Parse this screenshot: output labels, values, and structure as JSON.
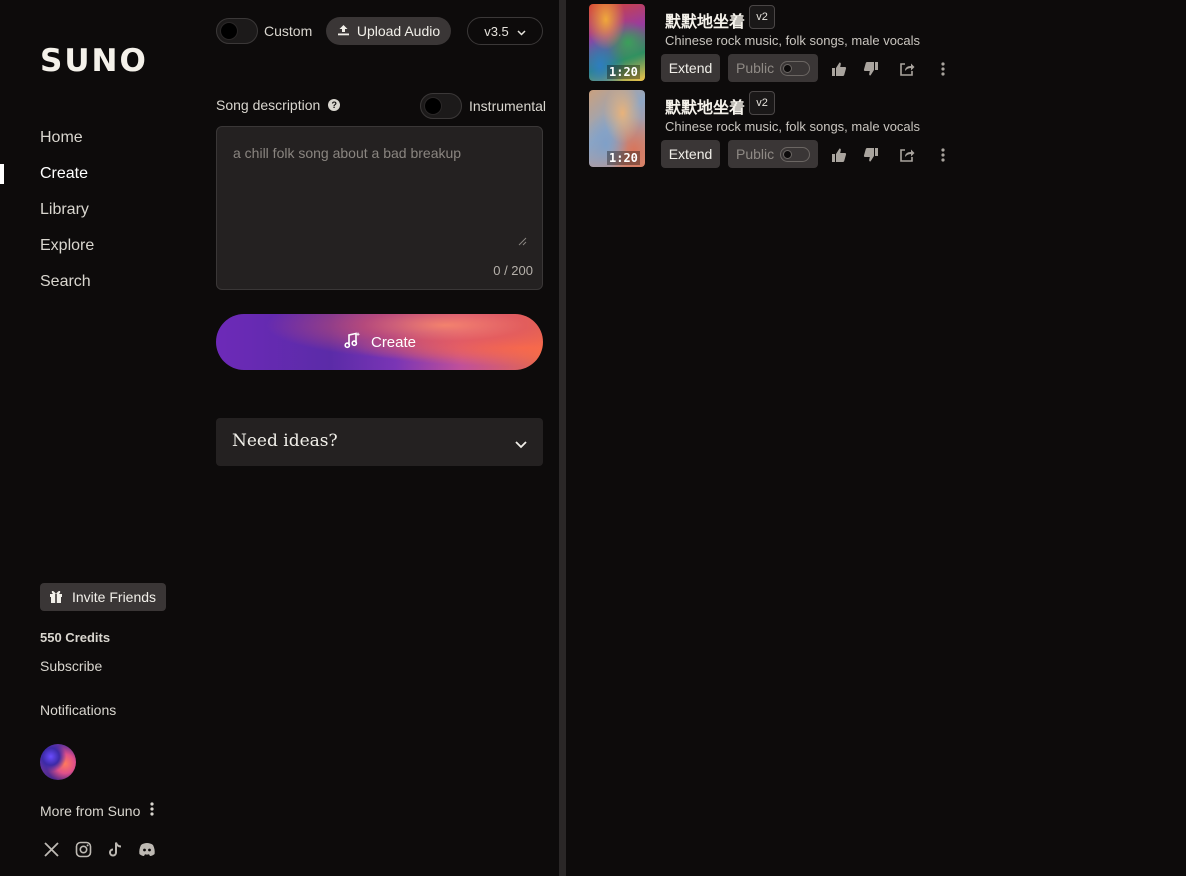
{
  "brand": {
    "logo": "SUNO"
  },
  "sidebar": {
    "nav": [
      {
        "label": "Home",
        "active": false
      },
      {
        "label": "Create",
        "active": true
      },
      {
        "label": "Library",
        "active": false
      },
      {
        "label": "Explore",
        "active": false
      },
      {
        "label": "Search",
        "active": false
      }
    ],
    "invite_label": "Invite Friends",
    "credits": "550 Credits",
    "subscribe": "Subscribe",
    "notifications": "Notifications",
    "more_from": "More from Suno",
    "socials": [
      "x-icon",
      "instagram-icon",
      "tiktok-icon",
      "discord-icon"
    ]
  },
  "create_panel": {
    "custom_label": "Custom",
    "custom_enabled": false,
    "upload_label": "Upload Audio",
    "version": "v3.5",
    "description_label": "Song description",
    "instrumental_label": "Instrumental",
    "instrumental_enabled": false,
    "description_placeholder": "a chill folk song about a bad breakup",
    "description_value": "",
    "counter": "0 / 200",
    "create_label": "Create",
    "ideas_label": "Need ideas?"
  },
  "songs": [
    {
      "title": "默默地坐着",
      "version_badge": "v2",
      "tags": "Chinese rock music, folk songs, male vocals",
      "duration": "1:20",
      "extend_label": "Extend",
      "public_label": "Public",
      "public": false
    },
    {
      "title": "默默地坐着",
      "version_badge": "v2",
      "tags": "Chinese rock music, folk songs, male vocals",
      "duration": "1:20",
      "extend_label": "Extend",
      "public_label": "Public",
      "public": false
    }
  ],
  "colors": {
    "background": "#0d0b0b",
    "surface": "#242121",
    "button": "#3a3636",
    "text": "#f1efe9",
    "create_gradient_start": "#6d2ab8",
    "create_gradient_end": "#e4674f"
  }
}
